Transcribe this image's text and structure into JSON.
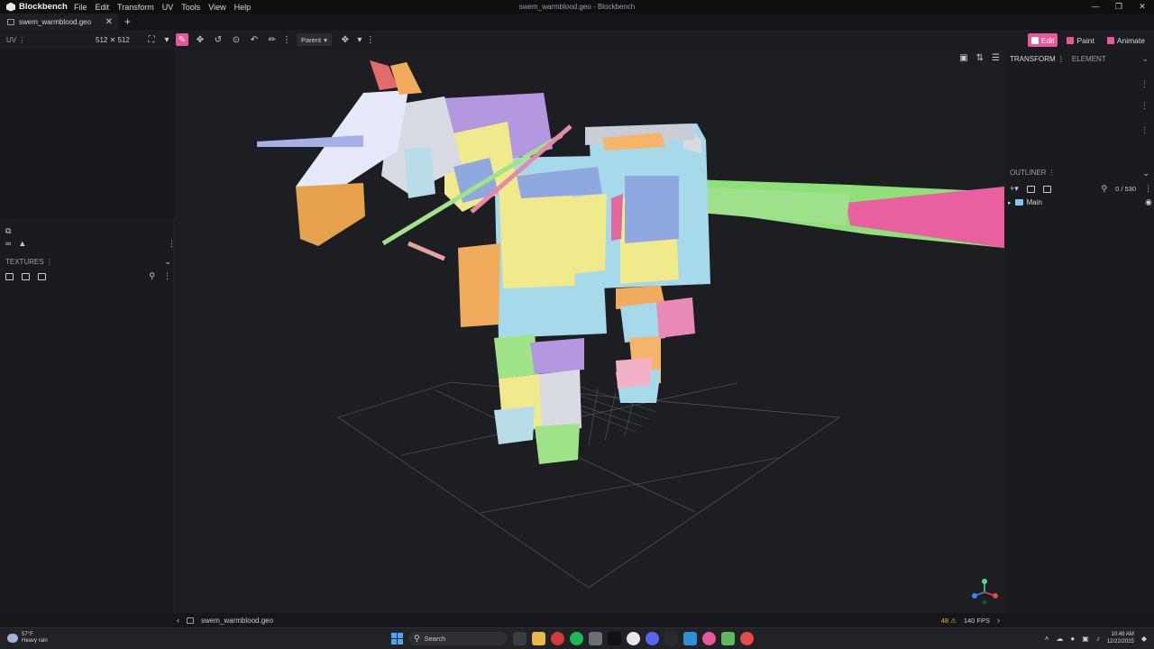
{
  "app": {
    "name": "Blockbench",
    "window_title": "swem_warmblood.geo - Blockbench",
    "menu": [
      "File",
      "Edit",
      "Transform",
      "UV",
      "Tools",
      "View",
      "Help"
    ]
  },
  "tabs": [
    {
      "label": "swem_warmblood.geo"
    }
  ],
  "toolbar": {
    "uv_label": "UV",
    "uv_size": "512 ✕ 512",
    "pivot_mode": "Parent",
    "modes": [
      {
        "label": "Edit",
        "active": true
      },
      {
        "label": "Paint",
        "active": false
      },
      {
        "label": "Animate",
        "active": false
      }
    ]
  },
  "left_panel": {
    "textures_label": "TEXTURES"
  },
  "right_panel": {
    "tabs": [
      "TRANSFORM",
      "ELEMENT"
    ],
    "outliner_label": "OUTLINER",
    "outliner_count": "0 / 530",
    "groups": [
      {
        "label": "Main"
      }
    ]
  },
  "status": {
    "file": "swem_warmblood.geo",
    "warnings": "48",
    "fps": "140 FPS"
  },
  "taskbar": {
    "weather_temp": "57°F",
    "weather_desc": "Heavy rain",
    "search_placeholder": "Search",
    "time": "10:49 AM",
    "date": "12/22/2025"
  },
  "colors": {
    "accent": "#e8599a",
    "folder": "#7ec8f0"
  }
}
